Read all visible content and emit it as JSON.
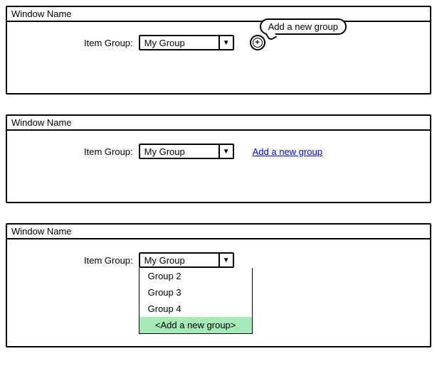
{
  "windows": {
    "w1": {
      "title": "Window Name",
      "label": "Item Group:",
      "selected": "My Group",
      "tooltip": "Add a new group"
    },
    "w2": {
      "title": "Window Name",
      "label": "Item Group:",
      "selected": "My Group",
      "link": "Add a new group"
    },
    "w3": {
      "title": "Window Name",
      "label": "Item Group:",
      "selected": "My Group",
      "options": {
        "o1": "Group 2",
        "o2": "Group 3",
        "o3": "Group 4",
        "add": "<Add a new group>"
      }
    }
  }
}
